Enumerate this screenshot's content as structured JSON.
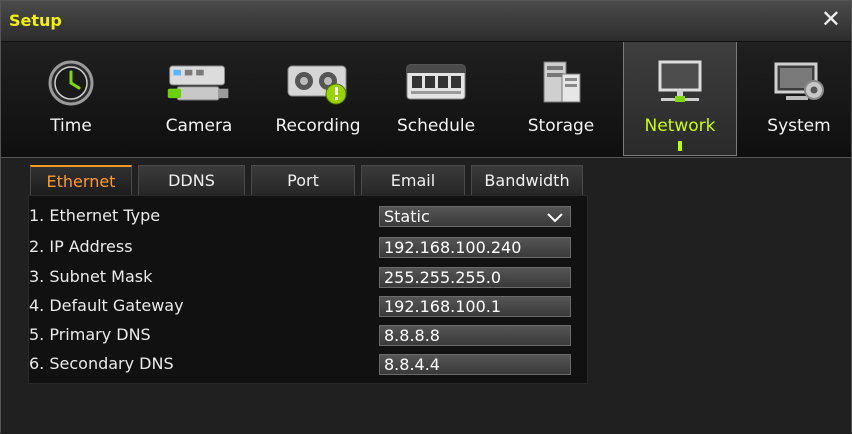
{
  "window": {
    "title": "Setup",
    "close_glyph": "✕"
  },
  "toolbar": {
    "items": [
      {
        "label": "Time",
        "icon": "clock-icon"
      },
      {
        "label": "Camera",
        "icon": "camera-icon"
      },
      {
        "label": "Recording",
        "icon": "recorder-icon"
      },
      {
        "label": "Schedule",
        "icon": "schedule-icon"
      },
      {
        "label": "Storage",
        "icon": "storage-icon"
      },
      {
        "label": "Network",
        "icon": "monitor-icon",
        "active": true
      },
      {
        "label": "System",
        "icon": "system-gear-icon"
      }
    ]
  },
  "tabs": [
    {
      "label": "Ethernet",
      "active": true
    },
    {
      "label": "DDNS"
    },
    {
      "label": "Port"
    },
    {
      "label": "Email"
    },
    {
      "label": "Bandwidth"
    }
  ],
  "ethernet": {
    "rows": [
      {
        "label": "1. Ethernet Type",
        "value": "Static"
      },
      {
        "label": "2. IP Address",
        "value": "192.168.100.240"
      },
      {
        "label": "3. Subnet Mask",
        "value": "255.255.255.0"
      },
      {
        "label": "4. Default Gateway",
        "value": "192.168.100.1"
      },
      {
        "label": "5. Primary DNS",
        "value": "8.8.8.8"
      },
      {
        "label": "6. Secondary DNS",
        "value": "8.8.4.4"
      }
    ]
  },
  "colors": {
    "title": "#f2f200",
    "active_nav": "#c8ff00",
    "active_tab": "#ff9a2a"
  }
}
